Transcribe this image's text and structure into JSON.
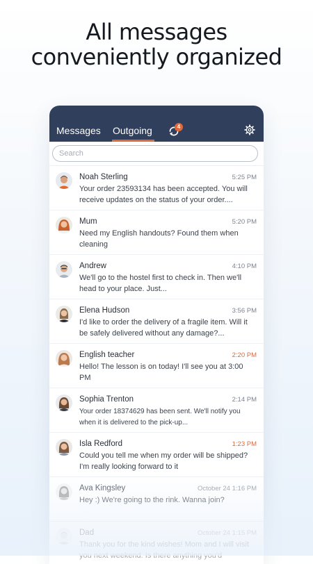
{
  "headline": {
    "line1": "All messages",
    "line2": "conveniently organized"
  },
  "app": {
    "tabs": [
      {
        "label": "Messages",
        "active": false
      },
      {
        "label": "Outgoing",
        "active": true
      }
    ],
    "sync_icon": "sync-icon",
    "sync_badge": "4",
    "settings_icon": "gear-icon",
    "search": {
      "placeholder": "Search",
      "value": ""
    },
    "colors": {
      "header": "#2f3f5c",
      "accent": "#e0693a"
    }
  },
  "conversations": [
    {
      "name": "Noah Sterling",
      "time": "5:25 PM",
      "preview": "Your order 23593134 has been accepted. You will receive updates on the status of your order....",
      "time_accent": false
    },
    {
      "name": "Mum",
      "time": "5:20 PM",
      "preview": "Need my English handouts? Found them when cleaning",
      "time_accent": false
    },
    {
      "name": "Andrew",
      "time": "4:10 PM",
      "preview": "We'll go to the hostel first to check in. Then we'll head to your place. Just...",
      "time_accent": false
    },
    {
      "name": "Elena Hudson",
      "time": "3:56 PM",
      "preview": "I'd like to order the delivery of a fragile item. Will it be safely delivered without any damage?...",
      "time_accent": false
    },
    {
      "name": "English teacher",
      "time": "2:20 PM",
      "preview": "Hello! The lesson is on today! I'll see you at 3:00 PM",
      "time_accent": true
    },
    {
      "name": "Sophia Trenton",
      "time": "2:14 PM",
      "preview": "Your order 18374629 has been sent. We'll notify you when it is delivered to the pick-up...",
      "time_accent": false
    },
    {
      "name": "Isla Redford",
      "time": "1:23 PM",
      "preview": "Could you tell me when my order will be shipped? I'm really looking forward to it",
      "time_accent": true
    },
    {
      "name": "Ava Kingsley",
      "time": "October 24 1:16 PM",
      "preview": "Hey :) We're going to the rink. Wanna join?",
      "time_accent": false
    },
    {
      "name": "Dad",
      "time": "October 24 1:15 PM",
      "preview": "Thank you for the kind wishes! Mom and I will visit you next weekend. Is there anything you'd",
      "time_accent": false
    }
  ]
}
